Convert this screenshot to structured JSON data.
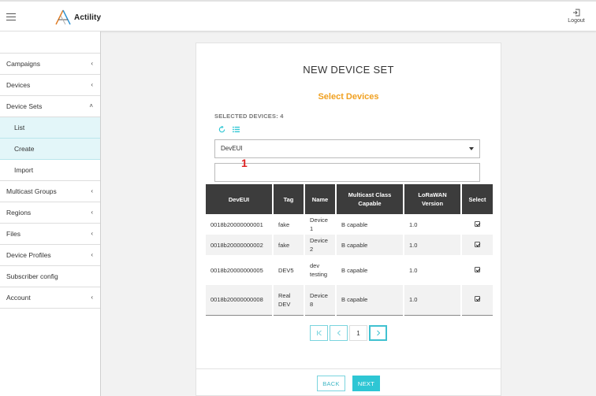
{
  "header": {
    "logo_text": "Actility",
    "logout_label": "Logout"
  },
  "sidebar": {
    "items": [
      {
        "label": "Campaigns",
        "chevron": "‹"
      },
      {
        "label": "Devices",
        "chevron": "‹"
      },
      {
        "label": "Device Sets",
        "chevron": "˄"
      },
      {
        "label": "List"
      },
      {
        "label": "Create"
      },
      {
        "label": "Import"
      },
      {
        "label": "Multicast Groups",
        "chevron": "‹"
      },
      {
        "label": "Regions",
        "chevron": "‹"
      },
      {
        "label": "Files",
        "chevron": "‹"
      },
      {
        "label": "Device Profiles",
        "chevron": "‹"
      },
      {
        "label": "Subscriber config"
      },
      {
        "label": "Account",
        "chevron": "‹"
      }
    ]
  },
  "main": {
    "title": "NEW DEVICE SET",
    "subtitle": "Select Devices",
    "selected_devices": "SELECTED DEVICES: 4",
    "filter_select": "DevEUI",
    "filter_input_value": "",
    "annotation_mark": "1",
    "table": {
      "headers": [
        "DevEUI",
        "Tag",
        "Name",
        "Multicast Class Capable",
        "LoRaWAN Version",
        "Select"
      ],
      "rows": [
        {
          "deveui": "0018b20000000001",
          "tag": "fake",
          "name": "Device 1",
          "mc": "B capable",
          "lora": "1.0"
        },
        {
          "deveui": "0018b20000000002",
          "tag": "fake",
          "name": "Device 2",
          "mc": "B capable",
          "lora": "1.0"
        },
        {
          "deveui": "0018b20000000005",
          "tag": "DEV5",
          "name": "dev testing",
          "mc": "B capable",
          "lora": "1.0"
        },
        {
          "deveui": "0018b20000000008",
          "tag": "Real DEV",
          "name": "Device 8",
          "mc": "B capable",
          "lora": "1.0"
        }
      ]
    },
    "pager": {
      "current_page": "1"
    },
    "buttons": {
      "back": "BACK",
      "next": "NEXT"
    }
  },
  "colors": {
    "accent": "#2ec6d4",
    "subtitle": "#f0a020",
    "table_header": "#3c3c3c",
    "active_nav": "#e3f6f9"
  },
  "icons": [
    "hamburger-icon",
    "actility-logo-icon",
    "logout-icon",
    "refresh-icon",
    "list-icon",
    "first-page-icon",
    "prev-page-icon",
    "next-page-icon",
    "checkbox-icon"
  ]
}
